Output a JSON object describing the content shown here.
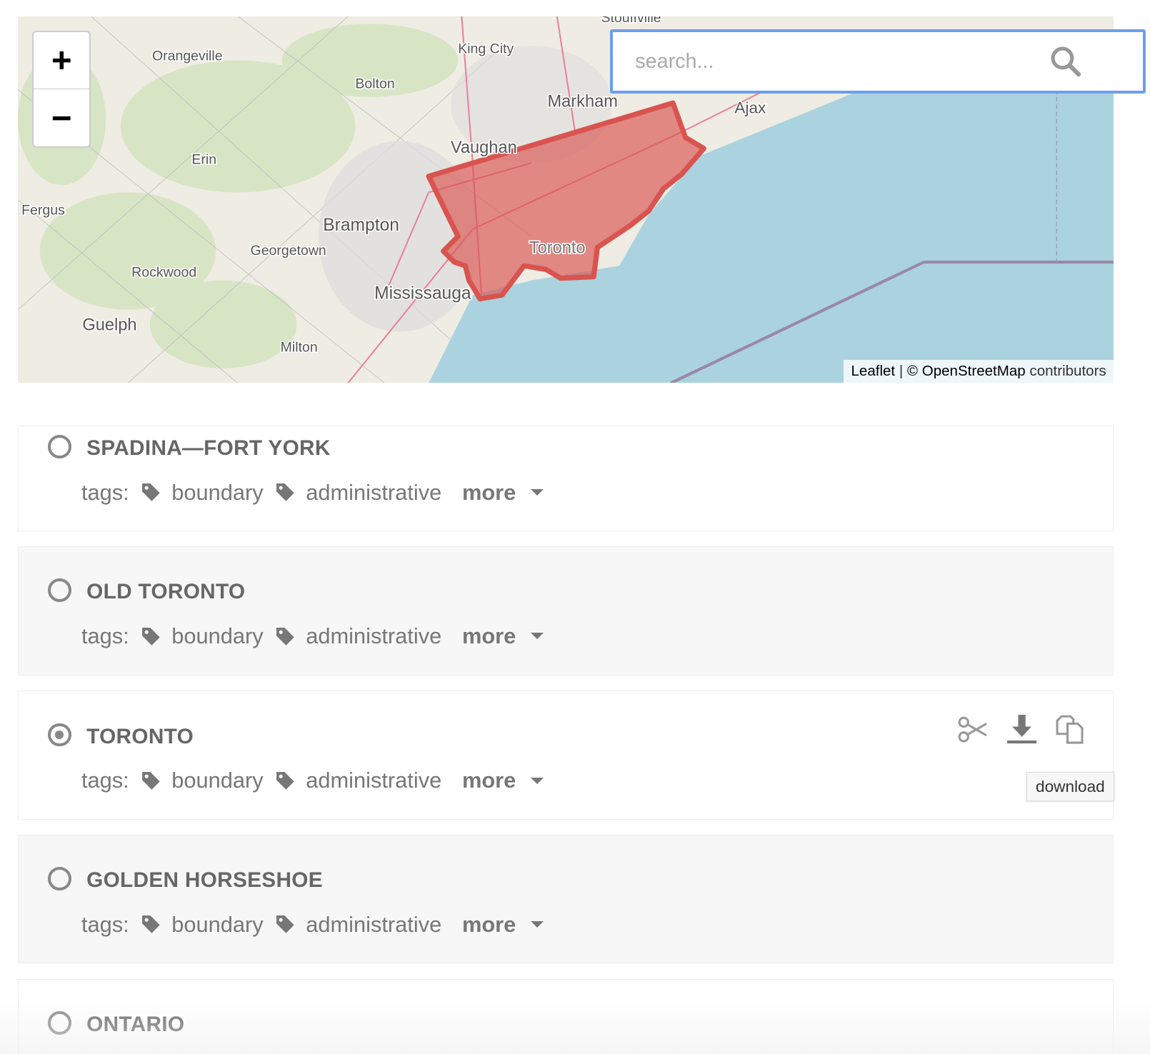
{
  "map": {
    "zoom_in": "+",
    "zoom_out": "−",
    "labels": [
      "Stouffville",
      "Orangeville",
      "King City",
      "Bolton",
      "Markham",
      "Ajax",
      "Vaughan",
      "Erin",
      "Fergus",
      "Brampton",
      "Georgetown",
      "Toronto",
      "Rockwood",
      "Mississauga",
      "Guelph",
      "Milton"
    ],
    "attribution": {
      "leaflet": "Leaflet",
      "sep": "|",
      "osm": "© OpenStreetMap",
      "contributors": "contributors"
    },
    "highlight_color": "#d9534f"
  },
  "search": {
    "placeholder": "search...",
    "icon": "search-icon"
  },
  "results": [
    {
      "name": "SPADINA—FORT YORK",
      "selected": false,
      "tags_label": "tags:",
      "tags": [
        "boundary",
        "administrative"
      ],
      "more": "more"
    },
    {
      "name": "OLD TORONTO",
      "selected": false,
      "tags_label": "tags:",
      "tags": [
        "boundary",
        "administrative"
      ],
      "more": "more"
    },
    {
      "name": "TORONTO",
      "selected": true,
      "tags_label": "tags:",
      "tags": [
        "boundary",
        "administrative"
      ],
      "more": "more",
      "actions": [
        "scissors-icon",
        "download-icon",
        "copy-icon"
      ],
      "tooltip": "download"
    },
    {
      "name": "GOLDEN HORSESHOE",
      "selected": false,
      "tags_label": "tags:",
      "tags": [
        "boundary",
        "administrative"
      ],
      "more": "more"
    },
    {
      "name": "ONTARIO",
      "selected": false
    }
  ]
}
